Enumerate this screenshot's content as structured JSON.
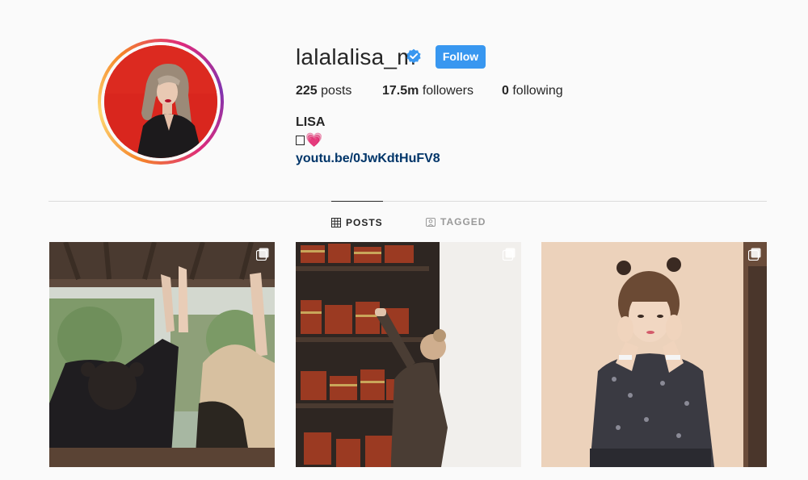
{
  "profile": {
    "username": "lalalalisa_m",
    "verified_icon": "verified-badge-icon",
    "follow_label": "Follow",
    "posts_count": "225",
    "posts_label": " posts",
    "followers_count": "17.5m",
    "followers_label": " followers",
    "following_count": "0",
    "following_label": " following",
    "full_name": "LISA",
    "bio_heart": "💗",
    "link": "youtu.be/0JwKdtHuFV8"
  },
  "tabs": [
    {
      "label": "POSTS",
      "icon": "grid-icon",
      "active": true
    },
    {
      "label": "TAGGED",
      "icon": "tagged-icon",
      "active": false
    }
  ],
  "posts": [
    {
      "icon": "multiple-posts-icon"
    },
    {
      "icon": "multiple-posts-icon"
    },
    {
      "icon": "multiple-posts-icon"
    }
  ],
  "colors": {
    "follow_button": "#3897f0",
    "link": "#003569",
    "verified": "#3897f0"
  }
}
